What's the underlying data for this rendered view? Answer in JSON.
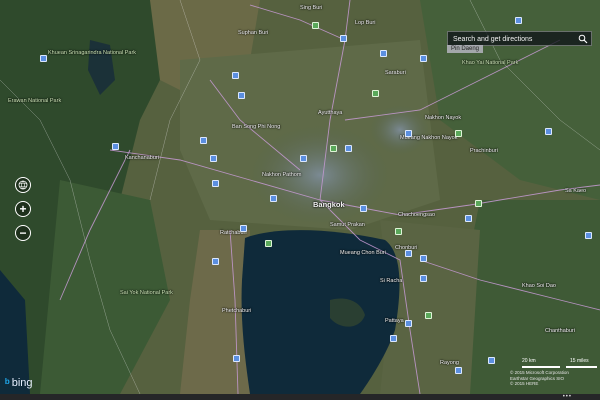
{
  "search": {
    "placeholder": "Search and get directions",
    "pin_label": "Pin Daeng"
  },
  "controls": {
    "zoom_in": "+",
    "zoom_out": "−"
  },
  "places": [
    {
      "name": "Bangkok",
      "major": true
    },
    {
      "name": "Si Racha",
      "major": false
    },
    {
      "name": "Rayong",
      "major": false
    },
    {
      "name": "Chonburi",
      "major": false
    },
    {
      "name": "Samut Prakan",
      "major": false
    },
    {
      "name": "Phetchaburi",
      "major": false
    },
    {
      "name": "Kanchanaburi",
      "major": false
    },
    {
      "name": "Nakhon Pathom",
      "major": false
    },
    {
      "name": "Ban Song Phi Nong",
      "major": false
    },
    {
      "name": "Ratchaburi",
      "major": false
    },
    {
      "name": "Chachoengsao",
      "major": false
    },
    {
      "name": "Prachinburi",
      "major": false
    },
    {
      "name": "Sa Kaeo",
      "major": false
    },
    {
      "name": "Khao Soi Dao",
      "major": false
    },
    {
      "name": "Chanthaburi",
      "major": false
    },
    {
      "name": "Pattaya",
      "major": false
    },
    {
      "name": "Saraburi",
      "major": false
    },
    {
      "name": "Lop Buri",
      "major": false
    },
    {
      "name": "Ayutthaya",
      "major": false
    },
    {
      "name": "Suphan Buri",
      "major": false
    },
    {
      "name": "Sing Buri",
      "major": false
    },
    {
      "name": "Nakhon Nayok",
      "major": false
    },
    {
      "name": "Mueang Chon Buri",
      "major": false
    },
    {
      "name": "Khao Yai National Park",
      "major": false
    },
    {
      "name": "Erawan National Park",
      "major": false
    },
    {
      "name": "Sai Yok National Park",
      "major": false
    },
    {
      "name": "Khuean Srinagarindra National Park",
      "major": false
    },
    {
      "name": "Mueang Nakhon Nayok",
      "major": false
    }
  ],
  "scale": {
    "km": "20 km",
    "miles": "15 miles"
  },
  "copyright": {
    "line1": "© 2015 Microsoft Corporation",
    "line2": "Earthstar Geographics SIO",
    "line3": "© 2015 HERE"
  },
  "branding": {
    "logo_text": "bing"
  },
  "colors": {
    "marker_blue": "#5b8fe0",
    "marker_green": "#5aa85a",
    "water": "#0f2a3a",
    "forest": "#2f4a2c"
  }
}
